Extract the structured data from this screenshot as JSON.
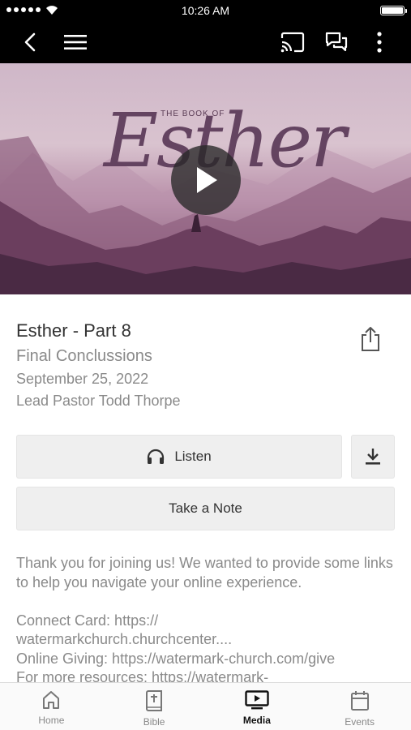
{
  "status_bar": {
    "time": "10:26 AM"
  },
  "hero": {
    "subtitle": "THE BOOK OF",
    "title": "Esther"
  },
  "sermon": {
    "title": "Esther - Part 8",
    "subtitle": "Final Conclussions",
    "date": "September 25, 2022",
    "speaker": "Lead Pastor Todd Thorpe"
  },
  "actions": {
    "listen_label": "Listen",
    "note_label": "Take a Note"
  },
  "description": {
    "intro": "Thank you for joining us! We wanted to provide some links to help you navigate your online experience.",
    "lines": [
      "Connect Card: https://",
      "watermarkchurch.churchcenter....",
      "Online Giving: https://watermark-church.com/give",
      "For more resources: https://watermark-"
    ]
  },
  "tabs": [
    {
      "label": "Home",
      "icon": "home-icon"
    },
    {
      "label": "Bible",
      "icon": "bible-icon"
    },
    {
      "label": "Media",
      "icon": "media-icon",
      "active": true
    },
    {
      "label": "Events",
      "icon": "calendar-icon"
    }
  ]
}
